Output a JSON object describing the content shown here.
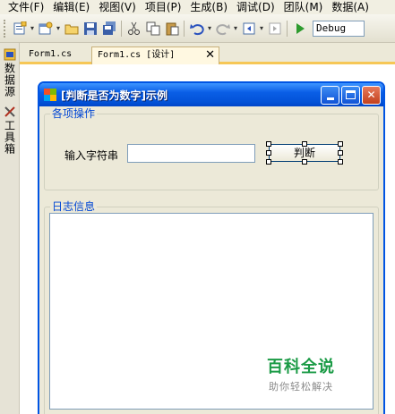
{
  "menu": [
    "文件(F)",
    "编辑(E)",
    "视图(V)",
    "项目(P)",
    "生成(B)",
    "调试(D)",
    "团队(M)",
    "数据(A)"
  ],
  "toolbar": {
    "config_value": "Debug"
  },
  "dock": {
    "datasource_label": "数据源",
    "toolbox_label": "工具箱"
  },
  "tabs": {
    "inactive_label": "Form1.cs",
    "active_label": "Form1.cs [设计]",
    "close_glyph": "✕"
  },
  "form": {
    "title": "[判断是否为数字]示例",
    "operations_group_label": "各项操作",
    "input_label": "输入字符串",
    "input_value": "",
    "check_button_label": "判断",
    "log_group_label": "日志信息"
  },
  "watermark": {
    "main": "百科全说",
    "sub": "助你轻松解决"
  }
}
